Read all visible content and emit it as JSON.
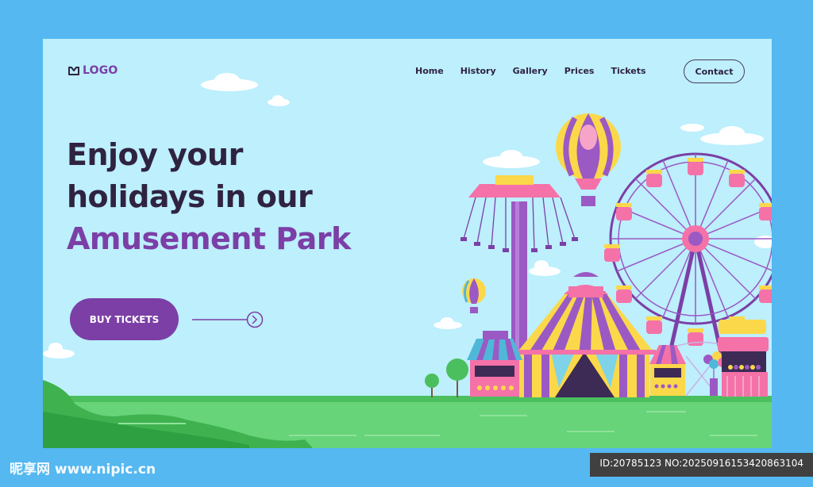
{
  "header": {
    "logo_text": "LOGO",
    "nav": [
      "Home",
      "History",
      "Gallery",
      "Prices",
      "Tickets"
    ],
    "contact_label": "Contact"
  },
  "hero": {
    "line1": "Enjoy your",
    "line2": "holidays in our",
    "line3": "Amusement Park",
    "cta_label": "BUY TICKETS"
  },
  "watermark": {
    "site": "昵享网 www.nipic.cn",
    "id": "ID:20785123 NO:20250916153420863104"
  },
  "colors": {
    "sky": "#bdeffd",
    "purple": "#7b3fa6",
    "dark": "#2f2340",
    "grass": "#5fcf6e",
    "pink": "#f472a8",
    "yellow": "#fbd84a"
  }
}
